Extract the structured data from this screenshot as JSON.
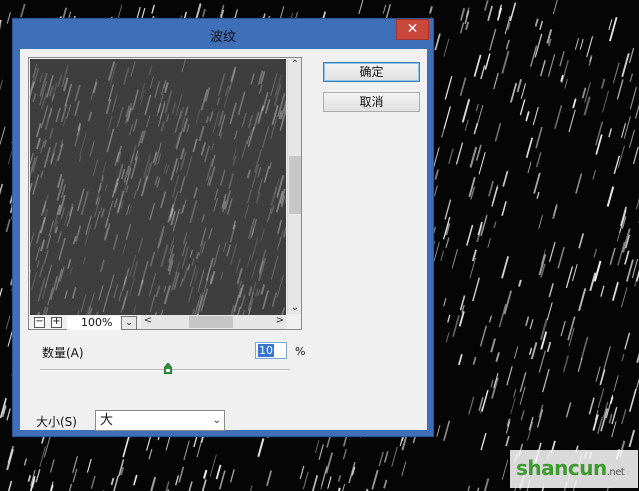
{
  "dialog": {
    "title": "波纹",
    "close_glyph": "✕"
  },
  "buttons": {
    "ok_label": "确定",
    "cancel_label": "取消"
  },
  "preview": {
    "zoom_value": "100%",
    "minus_glyph": "−",
    "plus_glyph": "+",
    "dropdown_glyph": "⌄",
    "scroll_up": "⌃",
    "scroll_down": "⌄",
    "scroll_left": "<",
    "scroll_right": ">"
  },
  "amount": {
    "label": "数量(A)",
    "value": "10",
    "unit": "%",
    "slider_fraction": 0.51
  },
  "size": {
    "label": "大小(S)",
    "selected": "大",
    "arrow_glyph": "⌄"
  },
  "watermark": {
    "text": "shancun",
    "sub": ".net"
  },
  "colors": {
    "titlebar": "#3f6fb8",
    "close": "#c9473b",
    "accent": "#3874d1"
  }
}
